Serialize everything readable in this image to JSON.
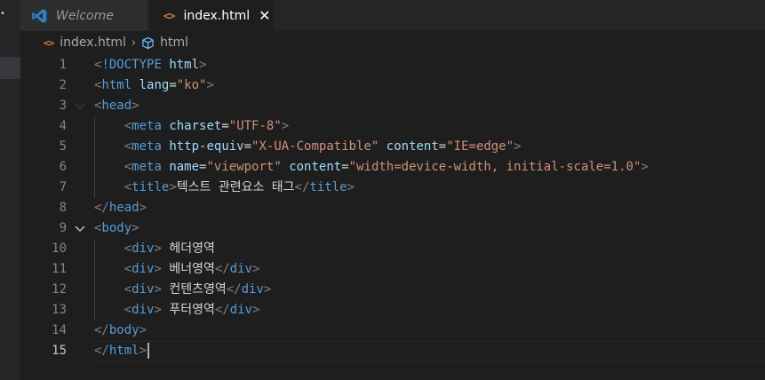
{
  "tabs": [
    {
      "label": "Welcome",
      "icon": "vscode-logo-icon",
      "active": false
    },
    {
      "label": "index.html",
      "icon": "html-file-icon",
      "active": true,
      "close_glyph": "✕"
    }
  ],
  "breadcrumb": {
    "file": "index.html",
    "symbol": "html"
  },
  "editor": {
    "active_line": 15,
    "lines": [
      {
        "n": "1",
        "tokens": [
          [
            "br",
            "<"
          ],
          [
            "t",
            "!DOCTYPE"
          ],
          [
            "x",
            " "
          ],
          [
            "a",
            "html"
          ],
          [
            "br",
            ">"
          ]
        ]
      },
      {
        "n": "2",
        "tokens": [
          [
            "br",
            "<"
          ],
          [
            "t",
            "html"
          ],
          [
            "x",
            " "
          ],
          [
            "a",
            "lang"
          ],
          [
            "x",
            "="
          ],
          [
            "s",
            "\"ko\""
          ],
          [
            "br",
            ">"
          ]
        ]
      },
      {
        "n": "3",
        "tokens": [
          [
            "br",
            "<"
          ],
          [
            "t",
            "head"
          ],
          [
            "br",
            ">"
          ]
        ]
      },
      {
        "n": "4",
        "tokens": [
          [
            "x",
            "    "
          ],
          [
            "br",
            "<"
          ],
          [
            "t",
            "meta"
          ],
          [
            "x",
            " "
          ],
          [
            "a",
            "charset"
          ],
          [
            "x",
            "="
          ],
          [
            "s",
            "\"UTF-8\""
          ],
          [
            "br",
            ">"
          ]
        ]
      },
      {
        "n": "5",
        "tokens": [
          [
            "x",
            "    "
          ],
          [
            "br",
            "<"
          ],
          [
            "t",
            "meta"
          ],
          [
            "x",
            " "
          ],
          [
            "a",
            "http-equiv"
          ],
          [
            "x",
            "="
          ],
          [
            "s",
            "\"X-UA-Compatible\""
          ],
          [
            "x",
            " "
          ],
          [
            "a",
            "content"
          ],
          [
            "x",
            "="
          ],
          [
            "s",
            "\"IE=edge\""
          ],
          [
            "br",
            ">"
          ]
        ]
      },
      {
        "n": "6",
        "tokens": [
          [
            "x",
            "    "
          ],
          [
            "br",
            "<"
          ],
          [
            "t",
            "meta"
          ],
          [
            "x",
            " "
          ],
          [
            "a",
            "name"
          ],
          [
            "x",
            "="
          ],
          [
            "s",
            "\"viewport\""
          ],
          [
            "x",
            " "
          ],
          [
            "a",
            "content"
          ],
          [
            "x",
            "="
          ],
          [
            "s",
            "\"width=device-width, initial-scale=1.0\""
          ],
          [
            "br",
            ">"
          ]
        ]
      },
      {
        "n": "7",
        "tokens": [
          [
            "x",
            "    "
          ],
          [
            "br",
            "<"
          ],
          [
            "t",
            "title"
          ],
          [
            "br",
            ">"
          ],
          [
            "x",
            "텍스트 관련요소 태그"
          ],
          [
            "br",
            "</"
          ],
          [
            "t",
            "title"
          ],
          [
            "br",
            ">"
          ]
        ]
      },
      {
        "n": "8",
        "tokens": [
          [
            "br",
            "</"
          ],
          [
            "t",
            "head"
          ],
          [
            "br",
            ">"
          ]
        ]
      },
      {
        "n": "9",
        "tokens": [
          [
            "br",
            "<"
          ],
          [
            "t",
            "body"
          ],
          [
            "br",
            ">"
          ]
        ]
      },
      {
        "n": "10",
        "tokens": [
          [
            "x",
            "    "
          ],
          [
            "br",
            "<"
          ],
          [
            "t",
            "div"
          ],
          [
            "br",
            ">"
          ],
          [
            "x",
            " 헤더영역"
          ]
        ]
      },
      {
        "n": "11",
        "tokens": [
          [
            "x",
            "    "
          ],
          [
            "br",
            "<"
          ],
          [
            "t",
            "div"
          ],
          [
            "br",
            ">"
          ],
          [
            "x",
            " 베너영역"
          ],
          [
            "br",
            "</"
          ],
          [
            "t",
            "div"
          ],
          [
            "br",
            ">"
          ]
        ]
      },
      {
        "n": "12",
        "tokens": [
          [
            "x",
            "    "
          ],
          [
            "br",
            "<"
          ],
          [
            "t",
            "div"
          ],
          [
            "br",
            ">"
          ],
          [
            "x",
            " 컨텐츠영역"
          ],
          [
            "br",
            "</"
          ],
          [
            "t",
            "div"
          ],
          [
            "br",
            ">"
          ]
        ]
      },
      {
        "n": "13",
        "tokens": [
          [
            "x",
            "    "
          ],
          [
            "br",
            "<"
          ],
          [
            "t",
            "div"
          ],
          [
            "br",
            ">"
          ],
          [
            "x",
            " 푸터영역"
          ],
          [
            "br",
            "</"
          ],
          [
            "t",
            "div"
          ],
          [
            "br",
            ">"
          ]
        ]
      },
      {
        "n": "14",
        "tokens": [
          [
            "br",
            "</"
          ],
          [
            "t",
            "body"
          ],
          [
            "br",
            ">"
          ]
        ]
      },
      {
        "n": "15",
        "tokens": [
          [
            "br",
            "</"
          ],
          [
            "t",
            "html"
          ],
          [
            "br",
            ">"
          ]
        ]
      }
    ],
    "fold_markers": {
      "3": "chevron-down-faint",
      "9": "chevron-down"
    }
  },
  "colors": {
    "background": "#1e1e1e",
    "tag": "#569cd6",
    "attribute": "#9cdcfe",
    "string": "#ce9178",
    "bracket": "#808080",
    "text": "#d4d4d4",
    "html_icon": "#e37933",
    "vscode_blue": "#2f80c8"
  }
}
